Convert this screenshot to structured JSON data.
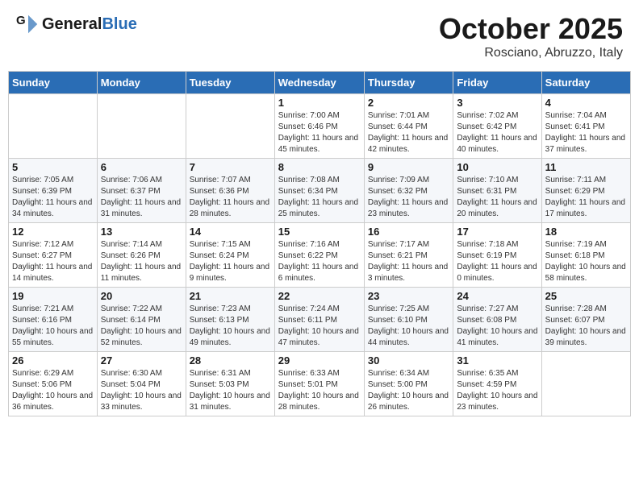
{
  "header": {
    "logo_general": "General",
    "logo_blue": "Blue",
    "month": "October 2025",
    "location": "Rosciano, Abruzzo, Italy"
  },
  "days_of_week": [
    "Sunday",
    "Monday",
    "Tuesday",
    "Wednesday",
    "Thursday",
    "Friday",
    "Saturday"
  ],
  "weeks": [
    [
      {
        "day": "",
        "info": ""
      },
      {
        "day": "",
        "info": ""
      },
      {
        "day": "",
        "info": ""
      },
      {
        "day": "1",
        "info": "Sunrise: 7:00 AM\nSunset: 6:46 PM\nDaylight: 11 hours and 45 minutes."
      },
      {
        "day": "2",
        "info": "Sunrise: 7:01 AM\nSunset: 6:44 PM\nDaylight: 11 hours and 42 minutes."
      },
      {
        "day": "3",
        "info": "Sunrise: 7:02 AM\nSunset: 6:42 PM\nDaylight: 11 hours and 40 minutes."
      },
      {
        "day": "4",
        "info": "Sunrise: 7:04 AM\nSunset: 6:41 PM\nDaylight: 11 hours and 37 minutes."
      }
    ],
    [
      {
        "day": "5",
        "info": "Sunrise: 7:05 AM\nSunset: 6:39 PM\nDaylight: 11 hours and 34 minutes."
      },
      {
        "day": "6",
        "info": "Sunrise: 7:06 AM\nSunset: 6:37 PM\nDaylight: 11 hours and 31 minutes."
      },
      {
        "day": "7",
        "info": "Sunrise: 7:07 AM\nSunset: 6:36 PM\nDaylight: 11 hours and 28 minutes."
      },
      {
        "day": "8",
        "info": "Sunrise: 7:08 AM\nSunset: 6:34 PM\nDaylight: 11 hours and 25 minutes."
      },
      {
        "day": "9",
        "info": "Sunrise: 7:09 AM\nSunset: 6:32 PM\nDaylight: 11 hours and 23 minutes."
      },
      {
        "day": "10",
        "info": "Sunrise: 7:10 AM\nSunset: 6:31 PM\nDaylight: 11 hours and 20 minutes."
      },
      {
        "day": "11",
        "info": "Sunrise: 7:11 AM\nSunset: 6:29 PM\nDaylight: 11 hours and 17 minutes."
      }
    ],
    [
      {
        "day": "12",
        "info": "Sunrise: 7:12 AM\nSunset: 6:27 PM\nDaylight: 11 hours and 14 minutes."
      },
      {
        "day": "13",
        "info": "Sunrise: 7:14 AM\nSunset: 6:26 PM\nDaylight: 11 hours and 11 minutes."
      },
      {
        "day": "14",
        "info": "Sunrise: 7:15 AM\nSunset: 6:24 PM\nDaylight: 11 hours and 9 minutes."
      },
      {
        "day": "15",
        "info": "Sunrise: 7:16 AM\nSunset: 6:22 PM\nDaylight: 11 hours and 6 minutes."
      },
      {
        "day": "16",
        "info": "Sunrise: 7:17 AM\nSunset: 6:21 PM\nDaylight: 11 hours and 3 minutes."
      },
      {
        "day": "17",
        "info": "Sunrise: 7:18 AM\nSunset: 6:19 PM\nDaylight: 11 hours and 0 minutes."
      },
      {
        "day": "18",
        "info": "Sunrise: 7:19 AM\nSunset: 6:18 PM\nDaylight: 10 hours and 58 minutes."
      }
    ],
    [
      {
        "day": "19",
        "info": "Sunrise: 7:21 AM\nSunset: 6:16 PM\nDaylight: 10 hours and 55 minutes."
      },
      {
        "day": "20",
        "info": "Sunrise: 7:22 AM\nSunset: 6:14 PM\nDaylight: 10 hours and 52 minutes."
      },
      {
        "day": "21",
        "info": "Sunrise: 7:23 AM\nSunset: 6:13 PM\nDaylight: 10 hours and 49 minutes."
      },
      {
        "day": "22",
        "info": "Sunrise: 7:24 AM\nSunset: 6:11 PM\nDaylight: 10 hours and 47 minutes."
      },
      {
        "day": "23",
        "info": "Sunrise: 7:25 AM\nSunset: 6:10 PM\nDaylight: 10 hours and 44 minutes."
      },
      {
        "day": "24",
        "info": "Sunrise: 7:27 AM\nSunset: 6:08 PM\nDaylight: 10 hours and 41 minutes."
      },
      {
        "day": "25",
        "info": "Sunrise: 7:28 AM\nSunset: 6:07 PM\nDaylight: 10 hours and 39 minutes."
      }
    ],
    [
      {
        "day": "26",
        "info": "Sunrise: 6:29 AM\nSunset: 5:06 PM\nDaylight: 10 hours and 36 minutes."
      },
      {
        "day": "27",
        "info": "Sunrise: 6:30 AM\nSunset: 5:04 PM\nDaylight: 10 hours and 33 minutes."
      },
      {
        "day": "28",
        "info": "Sunrise: 6:31 AM\nSunset: 5:03 PM\nDaylight: 10 hours and 31 minutes."
      },
      {
        "day": "29",
        "info": "Sunrise: 6:33 AM\nSunset: 5:01 PM\nDaylight: 10 hours and 28 minutes."
      },
      {
        "day": "30",
        "info": "Sunrise: 6:34 AM\nSunset: 5:00 PM\nDaylight: 10 hours and 26 minutes."
      },
      {
        "day": "31",
        "info": "Sunrise: 6:35 AM\nSunset: 4:59 PM\nDaylight: 10 hours and 23 minutes."
      },
      {
        "day": "",
        "info": ""
      }
    ]
  ]
}
